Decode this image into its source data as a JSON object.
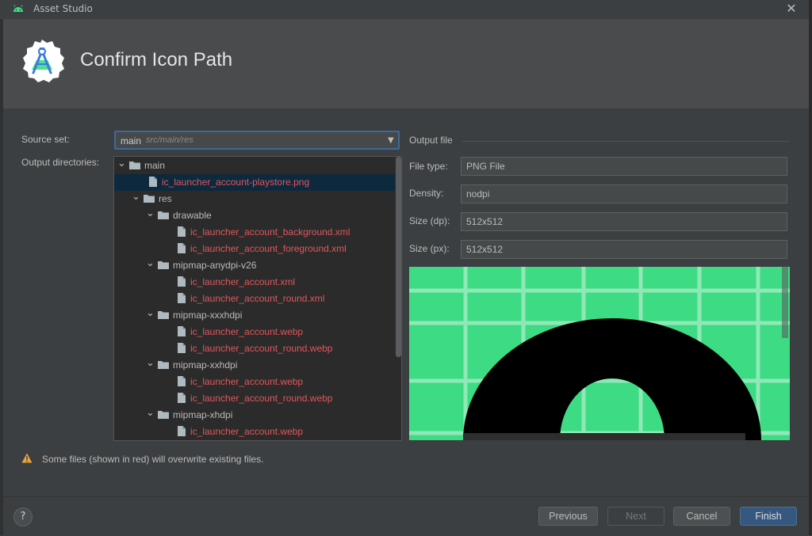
{
  "window": {
    "title": "Asset Studio",
    "icon": "android-icon",
    "close_icon": "close-icon"
  },
  "header": {
    "title": "Confirm Icon Path",
    "logo": "android-studio-logo"
  },
  "source_set": {
    "label": "Source set:",
    "value": "main",
    "path": "src/main/res"
  },
  "output_dirs": {
    "label": "Output directories:"
  },
  "tree": [
    {
      "text": "main",
      "type": "folder",
      "level": 0,
      "expanded": true,
      "red": false,
      "selected": false
    },
    {
      "text": "ic_launcher_account-playstore.png",
      "type": "file",
      "level": 1,
      "red": true,
      "selected": true
    },
    {
      "text": "res",
      "type": "folder",
      "level": 1,
      "expanded": true,
      "red": false,
      "selected": false
    },
    {
      "text": "drawable",
      "type": "folder",
      "level": 2,
      "expanded": true,
      "red": false,
      "selected": false
    },
    {
      "text": "ic_launcher_account_background.xml",
      "type": "file",
      "level": 3,
      "red": true,
      "selected": false
    },
    {
      "text": "ic_launcher_account_foreground.xml",
      "type": "file",
      "level": 3,
      "red": true,
      "selected": false
    },
    {
      "text": "mipmap-anydpi-v26",
      "type": "folder",
      "level": 2,
      "expanded": true,
      "red": false,
      "selected": false
    },
    {
      "text": "ic_launcher_account.xml",
      "type": "file",
      "level": 3,
      "red": true,
      "selected": false
    },
    {
      "text": "ic_launcher_account_round.xml",
      "type": "file",
      "level": 3,
      "red": true,
      "selected": false
    },
    {
      "text": "mipmap-xxxhdpi",
      "type": "folder",
      "level": 2,
      "expanded": true,
      "red": false,
      "selected": false
    },
    {
      "text": "ic_launcher_account.webp",
      "type": "file",
      "level": 3,
      "red": true,
      "selected": false
    },
    {
      "text": "ic_launcher_account_round.webp",
      "type": "file",
      "level": 3,
      "red": true,
      "selected": false
    },
    {
      "text": "mipmap-xxhdpi",
      "type": "folder",
      "level": 2,
      "expanded": true,
      "red": false,
      "selected": false
    },
    {
      "text": "ic_launcher_account.webp",
      "type": "file",
      "level": 3,
      "red": true,
      "selected": false
    },
    {
      "text": "ic_launcher_account_round.webp",
      "type": "file",
      "level": 3,
      "red": true,
      "selected": false
    },
    {
      "text": "mipmap-xhdpi",
      "type": "folder",
      "level": 2,
      "expanded": true,
      "red": false,
      "selected": false
    },
    {
      "text": "ic_launcher_account.webp",
      "type": "file",
      "level": 3,
      "red": true,
      "selected": false
    }
  ],
  "output_file": {
    "label": "Output file",
    "file_type": {
      "label": "File type:",
      "value": "PNG File"
    },
    "density": {
      "label": "Density:",
      "value": "nodpi"
    },
    "size_dp": {
      "label": "Size (dp):",
      "value": "512x512"
    },
    "size_px": {
      "label": "Size (px):",
      "value": "512x512"
    }
  },
  "preview": {
    "background": "#3ddc84",
    "grid": "#8fe9b6",
    "shape": "#000000"
  },
  "warning": {
    "text": "Some files (shown in red) will overwrite existing files.",
    "icon": "warning-icon",
    "color": "#e8a33d"
  },
  "buttons": {
    "previous": "Previous",
    "next": "Next",
    "cancel": "Cancel",
    "finish": "Finish",
    "help": "?"
  },
  "colors": {
    "accent": "#365880",
    "red_text": "#e0575b",
    "selection": "#0d293e"
  }
}
